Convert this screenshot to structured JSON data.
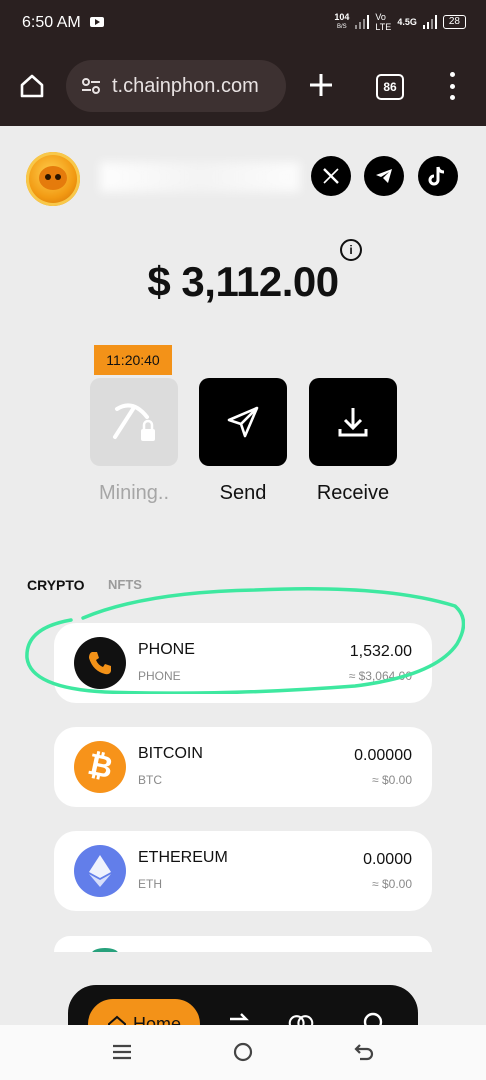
{
  "status_bar": {
    "time": "6:50 AM",
    "net_speed_value": "104",
    "net_speed_unit": "B/S",
    "sim1_label": "Vo LTE",
    "sim2_label": "4.5G",
    "battery": "28"
  },
  "browser": {
    "url": "t.chainphon.com",
    "tab_count": "86"
  },
  "balance": {
    "amount": "$ 3,112.00"
  },
  "actions": {
    "timer": "11:20:40",
    "mining_label": "Mining..",
    "send_label": "Send",
    "receive_label": "Receive"
  },
  "tabs": {
    "crypto": "CRYPTO",
    "nfts": "NFTS"
  },
  "assets": [
    {
      "name": "PHONE",
      "symbol": "PHONE",
      "amount": "1,532.00",
      "usd": "≈ $3,064.00",
      "icon": "phone-icon",
      "color": "#f39218"
    },
    {
      "name": "BITCOIN",
      "symbol": "BTC",
      "amount": "0.00000",
      "usd": "≈ $0.00",
      "icon": "bitcoin-icon",
      "color": "#f7931a"
    },
    {
      "name": "ETHEREUM",
      "symbol": "ETH",
      "amount": "0.0000",
      "usd": "≈ $0.00",
      "icon": "ethereum-icon",
      "color": "#627eea"
    }
  ],
  "bottom_nav": {
    "home_label": "Home"
  },
  "colors": {
    "accent": "#f39218",
    "highlight_stroke": "#3ee8a0"
  }
}
